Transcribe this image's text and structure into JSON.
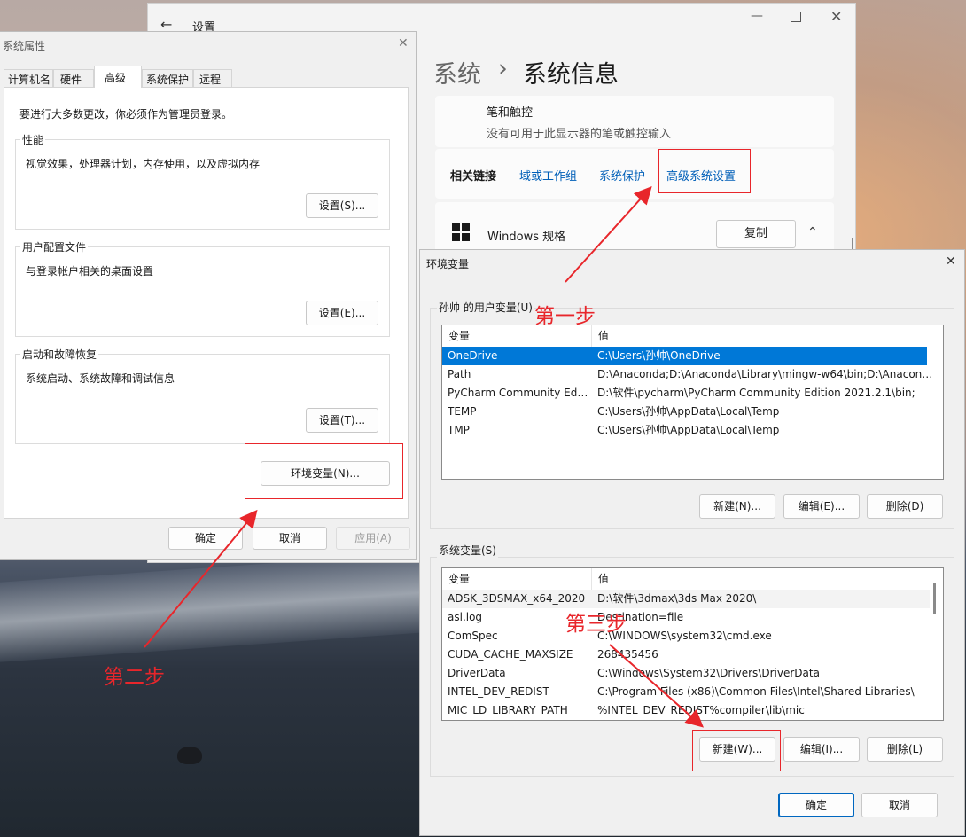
{
  "settings": {
    "title": "设置",
    "breadcrumb_root": "系统",
    "breadcrumb_sep": "›",
    "breadcrumb_page": "系统信息",
    "pen_title": "笔和触控",
    "pen_desc": "没有可用于此显示器的笔或触控输入",
    "related_label": "相关链接",
    "links": [
      "域或工作组",
      "系统保护",
      "高级系统设置"
    ],
    "windows_spec": "Windows 规格",
    "copy_label": "复制"
  },
  "sysprops": {
    "title": "系统属性",
    "tabs": [
      "计算机名",
      "硬件",
      "高级",
      "系统保护",
      "远程"
    ],
    "admin_note": "要进行大多数更改，你必须作为管理员登录。",
    "perf_label": "性能",
    "perf_desc": "视觉效果，处理器计划，内存使用，以及虚拟内存",
    "perf_btn": "设置(S)...",
    "profile_label": "用户配置文件",
    "profile_desc": "与登录帐户相关的桌面设置",
    "profile_btn": "设置(E)...",
    "startup_label": "启动和故障恢复",
    "startup_desc": "系统启动、系统故障和调试信息",
    "startup_btn": "设置(T)...",
    "env_btn": "环境变量(N)...",
    "ok": "确定",
    "cancel": "取消",
    "apply": "应用(A)"
  },
  "envvars": {
    "title": "环境变量",
    "user_label": "孙帅 的用户变量(U)",
    "col_var": "变量",
    "col_val": "值",
    "user_rows": [
      {
        "name": "OneDrive",
        "value": "C:\\Users\\孙帅\\OneDrive"
      },
      {
        "name": "Path",
        "value": "D:\\Anaconda;D:\\Anaconda\\Library\\mingw-w64\\bin;D:\\Anaconda..."
      },
      {
        "name": "PyCharm Community Editi...",
        "value": "D:\\软件\\pycharm\\PyCharm Community Edition 2021.2.1\\bin;"
      },
      {
        "name": "TEMP",
        "value": "C:\\Users\\孙帅\\AppData\\Local\\Temp"
      },
      {
        "name": "TMP",
        "value": "C:\\Users\\孙帅\\AppData\\Local\\Temp"
      }
    ],
    "user_new": "新建(N)...",
    "user_edit": "编辑(E)...",
    "user_del": "删除(D)",
    "sys_label": "系统变量(S)",
    "sys_rows": [
      {
        "name": "ADSK_3DSMAX_x64_2020",
        "value": "D:\\软件\\3dmax\\3ds Max 2020\\"
      },
      {
        "name": "asl.log",
        "value": "Destination=file"
      },
      {
        "name": "ComSpec",
        "value": "C:\\WINDOWS\\system32\\cmd.exe"
      },
      {
        "name": "CUDA_CACHE_MAXSIZE",
        "value": "268435456"
      },
      {
        "name": "DriverData",
        "value": "C:\\Windows\\System32\\Drivers\\DriverData"
      },
      {
        "name": "INTEL_DEV_REDIST",
        "value": "C:\\Program Files (x86)\\Common Files\\Intel\\Shared Libraries\\"
      },
      {
        "name": "MIC_LD_LIBRARY_PATH",
        "value": "%INTEL_DEV_REDIST%compiler\\lib\\mic"
      }
    ],
    "sys_new": "新建(W)...",
    "sys_edit": "编辑(I)...",
    "sys_del": "删除(L)",
    "ok": "确定",
    "cancel": "取消"
  },
  "annotations": {
    "step1": "第一步",
    "step2": "第二步",
    "step3": "第三步",
    "color": "#e8262b"
  }
}
